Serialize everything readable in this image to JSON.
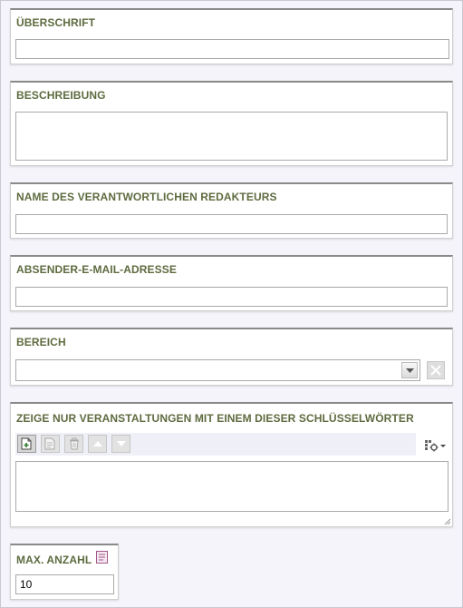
{
  "fields": {
    "ueberschrift": {
      "label": "ÜBERSCHRIFT",
      "value": ""
    },
    "beschreibung": {
      "label": "BESCHREIBUNG",
      "value": ""
    },
    "redakteur": {
      "label": "NAME DES VERANTWORTLICHEN REDAKTEURS",
      "value": ""
    },
    "absender": {
      "label": "ABSENDER-E-MAIL-ADRESSE",
      "value": ""
    },
    "bereich": {
      "label": "BEREICH",
      "selected": ""
    },
    "schluesselwoerter": {
      "label": "ZEIGE NUR VERANSTALTUNGEN MIT EINEM DIESER SCHLÜSSELWÖRTER",
      "toolbar": [
        "add-icon",
        "edit-icon",
        "delete-icon",
        "move-up-icon",
        "move-down-icon"
      ],
      "settings_icon": "settings-icon",
      "value": ""
    },
    "max_anzahl": {
      "label": "MAX. ANZAHL",
      "value": "10",
      "info_icon": "info-icon"
    }
  },
  "colors": {
    "label": "#5e6b3f",
    "page_background": "#f4f4fa",
    "panel_border_top": "#8a8a8a"
  }
}
